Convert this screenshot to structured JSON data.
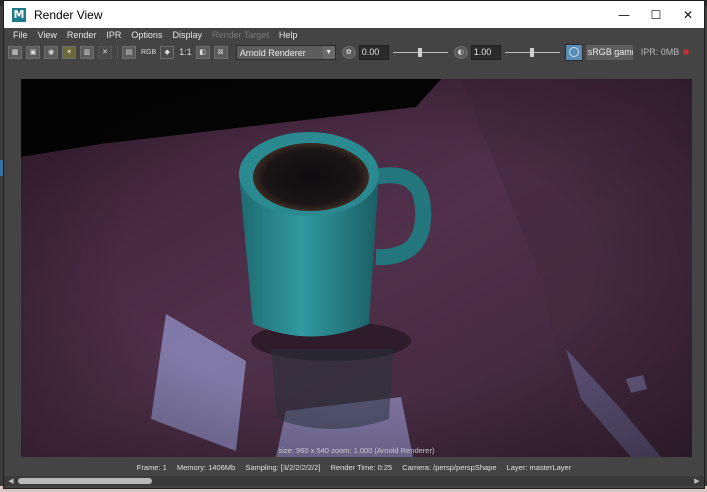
{
  "window": {
    "title": "Render View",
    "app_icon_letter": "M",
    "controls": {
      "minimize": "—",
      "maximize": "☐",
      "close": "✕"
    }
  },
  "menu": [
    "File",
    "View",
    "Render",
    "IPR",
    "Options",
    "Display",
    "Render Target",
    "Help"
  ],
  "menu_disabled": [
    "Render Target"
  ],
  "toolbar": {
    "rgb_label": "RGB",
    "one_to_one": "1:1",
    "renderer": "Arnold Renderer",
    "exposure_value": "0.00",
    "exposure_slider": 0.5,
    "gamma_value": "1.00",
    "gamma_slider": 0.5,
    "color_space": "sRGB gamma",
    "ipr_memory": "IPR: 0MB"
  },
  "viewport": {
    "overlay": "size: 960 x 540  zoom: 1.000      (Arnold Renderer)"
  },
  "status": {
    "frame": "Frame: 1",
    "memory": "Memory: 1406Mb",
    "sampling": "Sampling: [3/2/2/2/2/2]",
    "render_time": "Render Time: 0:25",
    "camera": "Camera: /persp/perspShape",
    "layer": "Layer: masterLayer"
  },
  "scrollbar": {
    "thumb_fraction": 0.2
  },
  "colors": {
    "accent": "#5a8db5",
    "mug": "#2e8c91",
    "table": "#4a2a44",
    "background": "#444444"
  }
}
